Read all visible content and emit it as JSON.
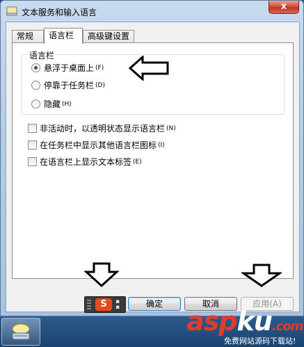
{
  "window": {
    "title": "文本服务和输入语言",
    "close_label": "x"
  },
  "tabs": [
    {
      "label": "常规",
      "active": false
    },
    {
      "label": "语言栏",
      "active": true
    },
    {
      "label": "高级键设置",
      "active": false
    }
  ],
  "language_bar_group": {
    "label": "语言栏",
    "options": [
      {
        "label": "悬浮于桌面上",
        "hotkey": "(F)",
        "checked": true
      },
      {
        "label": "停靠于任务栏",
        "hotkey": "(D)",
        "checked": false
      },
      {
        "label": "隐藏",
        "hotkey": "(H)",
        "checked": false
      }
    ]
  },
  "checkboxes": [
    {
      "label": "非活动时，以透明状态显示语言栏",
      "hotkey": "(N)",
      "checked": false
    },
    {
      "label": "在任务栏中显示其他语言栏图标",
      "hotkey": "(I)",
      "checked": false
    },
    {
      "label": "在语言栏上显示文本标签",
      "hotkey": "(E)",
      "checked": false
    }
  ],
  "buttons": {
    "ok": "确定",
    "cancel": "取消",
    "apply": "应用(A)"
  },
  "ime_bar": {
    "logo": "S"
  },
  "watermark": {
    "brand_a": "asp",
    "brand_b": "ku",
    "brand_c": ".com",
    "tagline": "免费网站源码下载站!"
  },
  "colors": {
    "arrow_stroke": "#000000",
    "watermark_red": "#e23b2c",
    "ime_orange": "#e8491e"
  }
}
